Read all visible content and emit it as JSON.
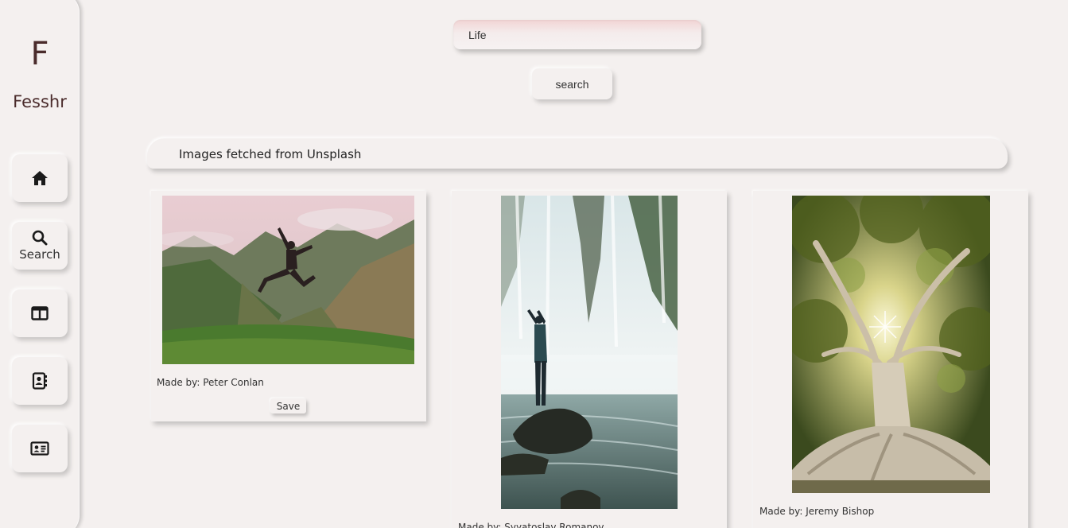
{
  "brand": {
    "letter": "F",
    "name": "Fesshr"
  },
  "sidebar": {
    "items": [
      {
        "icon": "home-icon",
        "label": ""
      },
      {
        "icon": "search-icon",
        "label": "Search"
      },
      {
        "icon": "columns-icon",
        "label": ""
      },
      {
        "icon": "contact-book-icon",
        "label": ""
      },
      {
        "icon": "id-card-icon",
        "label": ""
      }
    ]
  },
  "search": {
    "value": "Life",
    "button_label": "search"
  },
  "banner": {
    "title": "Images fetched from Unsplash"
  },
  "cards": [
    {
      "credit": "Made by: Peter Conlan",
      "save_label": "Save"
    },
    {
      "credit": "Made by: Svyatoslav Romanov"
    },
    {
      "credit": "Made by: Jeremy Bishop"
    }
  ],
  "colors": {
    "background": "#f4f0ef",
    "brand": "#4a2b2b",
    "input_tint": "#f2d4d4"
  }
}
